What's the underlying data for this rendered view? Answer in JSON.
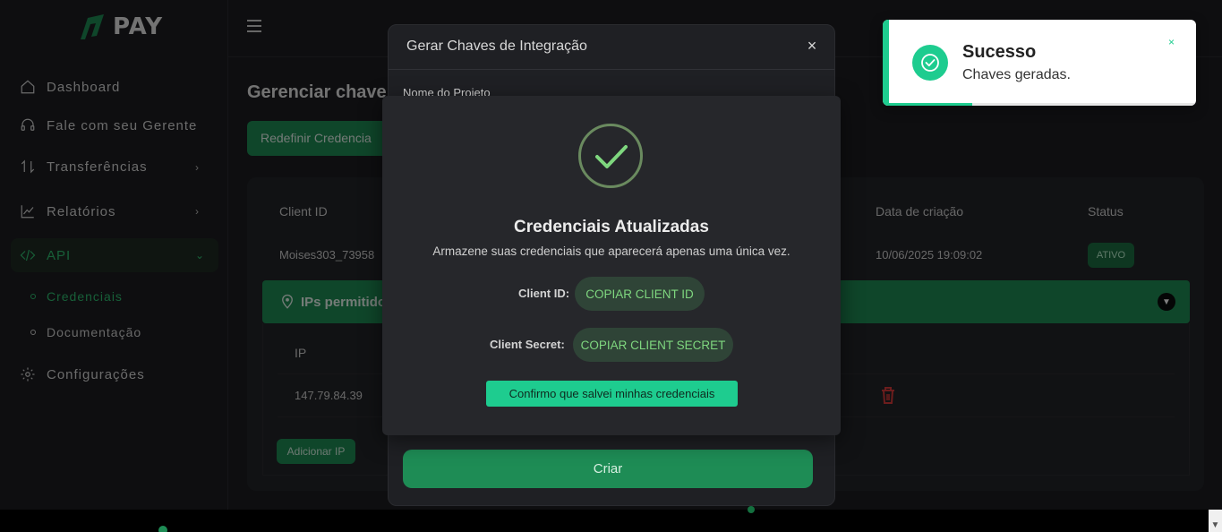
{
  "brand": {
    "name": "PAY",
    "accent": "#1e8c55",
    "success": "#1ecc8f"
  },
  "sidebar": {
    "items": [
      {
        "label": "Dashboard",
        "icon": "home-icon"
      },
      {
        "label": "Fale com seu Gerente",
        "icon": "headset-icon"
      },
      {
        "label": "Transferências",
        "icon": "transfer-icon",
        "has_submenu": true
      },
      {
        "label": "Relatórios",
        "icon": "chart-icon",
        "has_submenu": true
      },
      {
        "label": "API",
        "icon": "code-icon",
        "expanded": true,
        "active": true
      },
      {
        "label": "Configurações",
        "icon": "gear-icon"
      }
    ],
    "api_sub": [
      {
        "label": "Credenciais",
        "active": true
      },
      {
        "label": "Documentação"
      }
    ]
  },
  "page": {
    "title": "Gerenciar chave",
    "redefine_button": "Redefinir Credencia",
    "table": {
      "headers": [
        "Client ID",
        "Data de criação",
        "Status"
      ],
      "row": {
        "client_id": "Moises303_73958",
        "created": "10/06/2025 19:09:02",
        "status": "ATIVO"
      }
    },
    "ips": {
      "title": "IPs permitido",
      "header": "IP",
      "rows": [
        "147.79.84.39"
      ],
      "add_button": "Adicionar IP"
    }
  },
  "gen_modal": {
    "title": "Gerar Chaves de Integração",
    "field_label": "Nome do Projeto",
    "submit": "Criar"
  },
  "cred_modal": {
    "title": "Credenciais Atualizadas",
    "description": "Armazene suas credenciais que aparecerá apenas uma única vez.",
    "client_id_label": "Client ID:",
    "client_id_button": "COPIAR CLIENT ID",
    "client_secret_label": "Client Secret:",
    "client_secret_button": "COPIAR CLIENT SECRET",
    "confirm_button": "Confirmo que salvei minhas credenciais"
  },
  "toast": {
    "title": "Sucesso",
    "message": "Chaves geradas.",
    "close": "×",
    "progress": 0.27
  }
}
